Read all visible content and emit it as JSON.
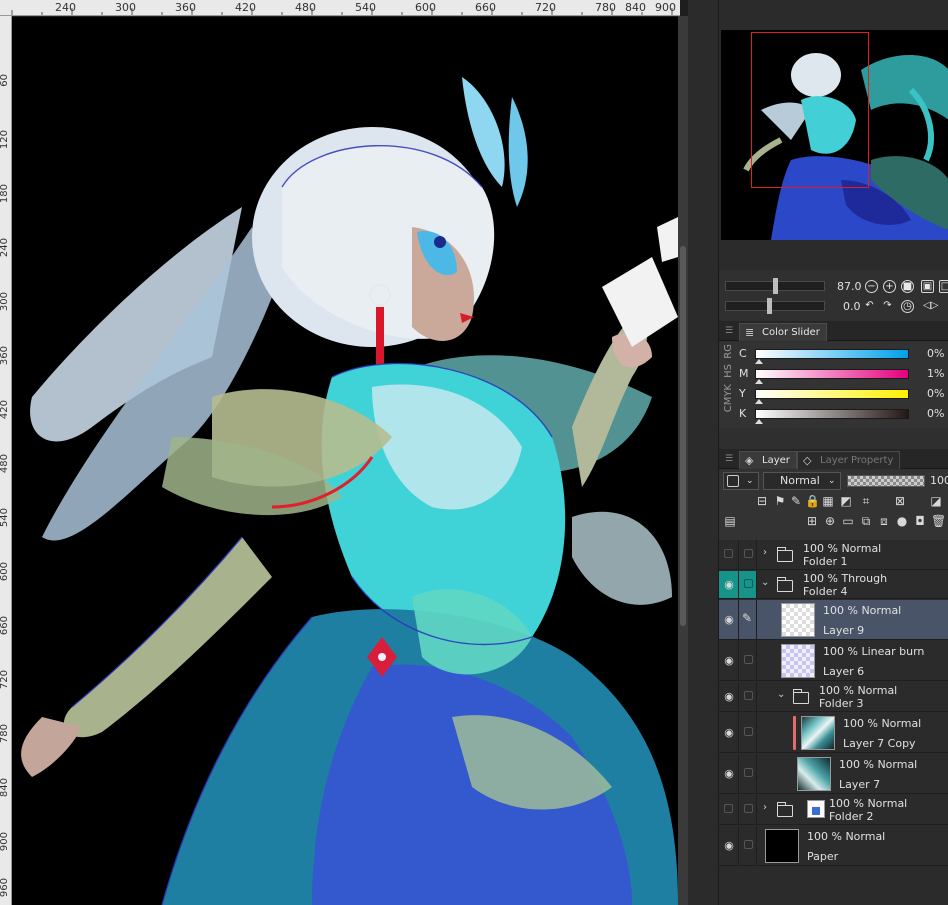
{
  "ruler": {
    "top": [
      "240",
      "300",
      "360",
      "420",
      "480",
      "540",
      "600",
      "660",
      "720",
      "780",
      "840",
      "900"
    ],
    "left": [
      "60",
      "120",
      "180",
      "240",
      "300",
      "360",
      "420",
      "480",
      "540",
      "600",
      "660",
      "720",
      "780",
      "840",
      "900",
      "960"
    ]
  },
  "navigator": {
    "zoom": "87.0",
    "rotation": "0.0"
  },
  "color_slider": {
    "tab_label": "Color Slider",
    "side_labels": [
      "RG",
      "HS",
      "CMYK"
    ],
    "channels": [
      {
        "label": "C",
        "value": "0%",
        "gradient": "linear-gradient(90deg,#ffffff,#00a0e9)"
      },
      {
        "label": "M",
        "value": "1%",
        "gradient": "linear-gradient(90deg,#ffffff,#e4007f)"
      },
      {
        "label": "Y",
        "value": "0%",
        "gradient": "linear-gradient(90deg,#ffffff,#fff100)"
      },
      {
        "label": "K",
        "value": "0%",
        "gradient": "linear-gradient(90deg,#ffffff,#231815)"
      }
    ]
  },
  "layer_panel": {
    "tab_layer": "Layer",
    "tab_property": "Layer Property",
    "blend_mode": "Normal",
    "opacity": "100"
  },
  "layers": [
    {
      "mode": "100 % Normal",
      "name": "Folder 1"
    },
    {
      "mode": "100 % Through",
      "name": "Folder 4"
    },
    {
      "mode": "100 % Normal",
      "name": "Layer 9"
    },
    {
      "mode": "100 % Linear burn",
      "name": "Layer 6"
    },
    {
      "mode": "100 % Normal",
      "name": "Folder 3"
    },
    {
      "mode": "100 % Normal",
      "name": "Layer 7 Copy"
    },
    {
      "mode": "100 % Normal",
      "name": "Layer 7"
    },
    {
      "mode": "100 % Normal",
      "name": "Folder 2"
    },
    {
      "mode": "100 % Normal",
      "name": "Paper"
    }
  ],
  "colors": {
    "selected_row": "#495469",
    "teal_visibility": "#17948a",
    "nav_frame": "#e02020"
  },
  "icons": {
    "eye": "eye-icon",
    "pen": "pen-icon",
    "folder": "folder-icon",
    "chevron": "chevron-icon"
  }
}
